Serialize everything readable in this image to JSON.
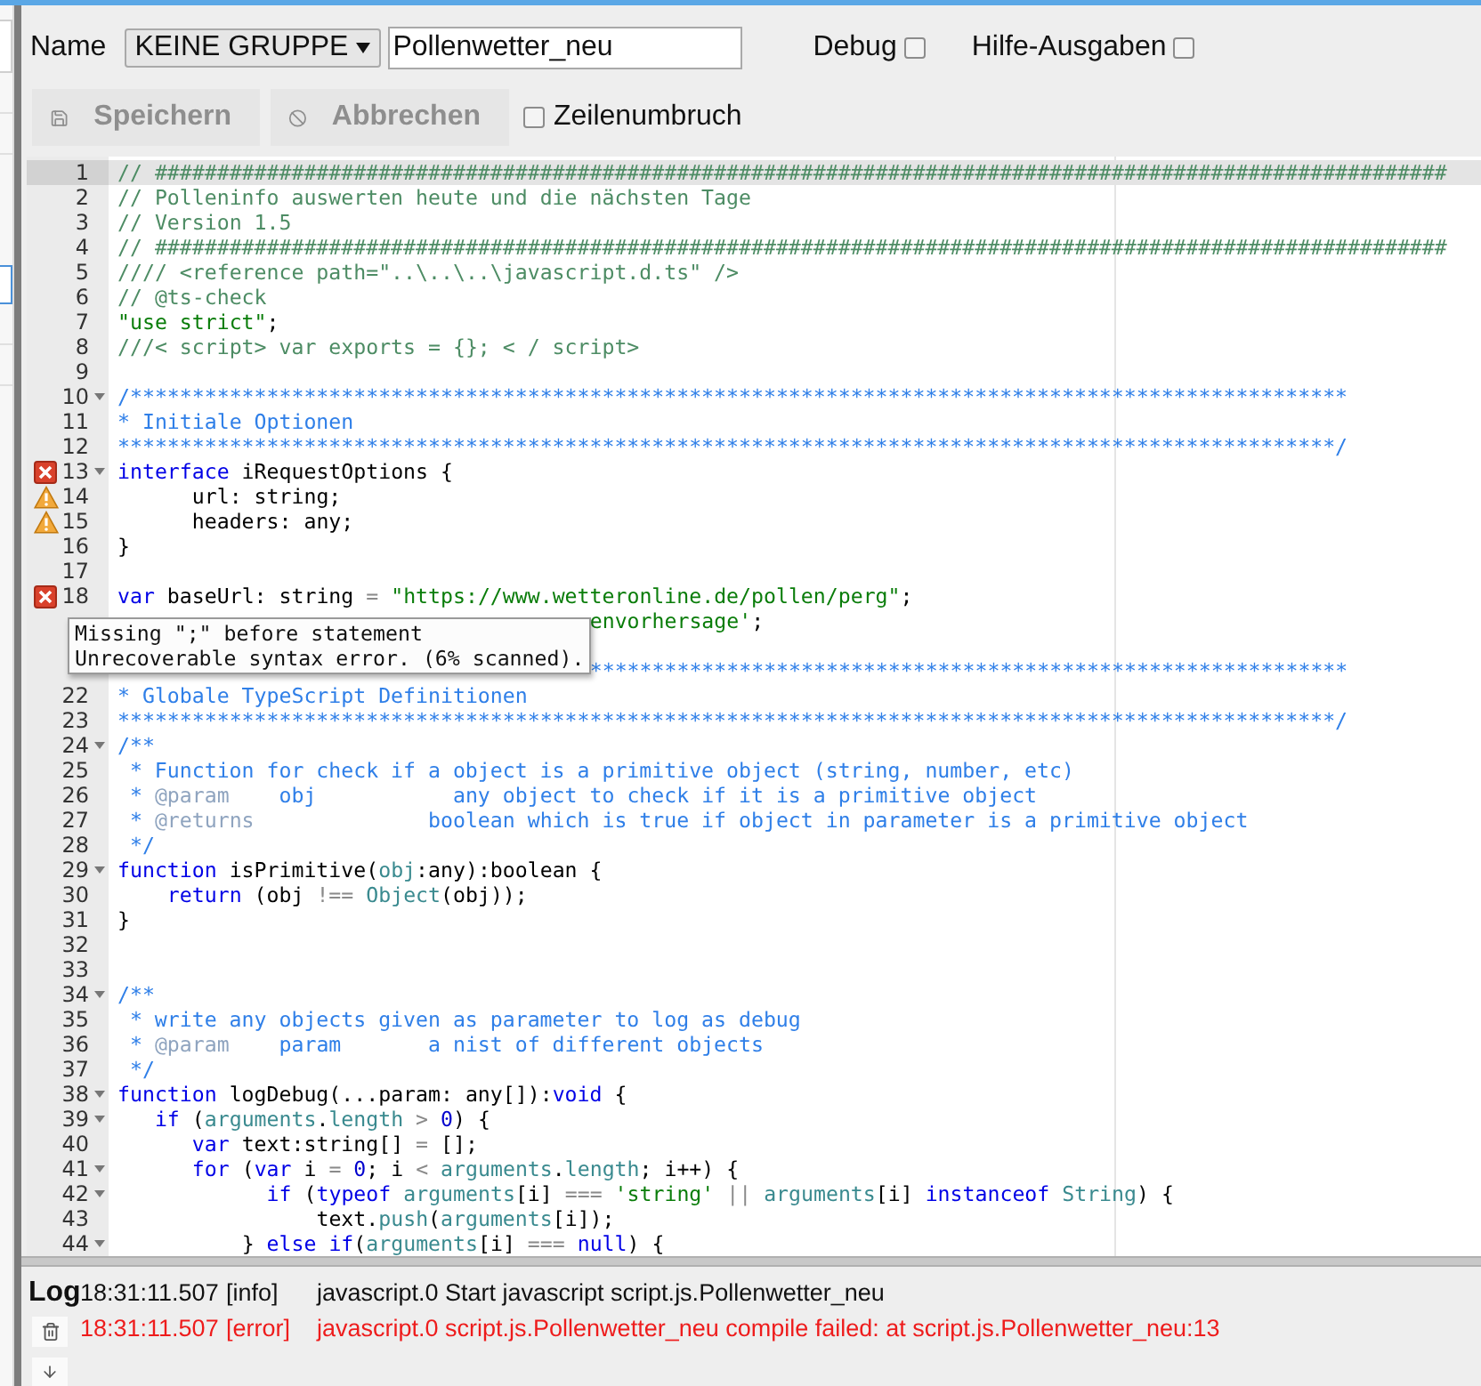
{
  "toolbar": {
    "name_label": "Name",
    "group_select": {
      "value": "KEINE GRUPPE"
    },
    "name_field": {
      "value": "Pollenwetter_neu"
    },
    "checkboxes": [
      {
        "label": "Debug",
        "checked": false
      },
      {
        "label": "Hilfe-Ausgaben",
        "checked": false
      }
    ],
    "buttons": [
      {
        "label": "Speichern",
        "kind": "save",
        "disabled": true
      },
      {
        "label": "Abbrechen",
        "kind": "cancel",
        "disabled": true
      }
    ],
    "wrap_checkbox": {
      "label": "Zeilenumbruch",
      "checked": false
    }
  },
  "editor": {
    "lines": [
      {
        "number": "1",
        "kind": "code",
        "fold": false,
        "active": true,
        "tokens": [
          {
            "kind": "comment",
            "text": "// ########################################################################################################"
          }
        ]
      },
      {
        "number": "2",
        "kind": "code",
        "fold": false,
        "active": false,
        "tokens": [
          {
            "kind": "comment",
            "text": "// Polleninfo auswerten heute und die nächsten Tage"
          }
        ]
      },
      {
        "number": "3",
        "kind": "code",
        "fold": false,
        "active": false,
        "tokens": [
          {
            "kind": "comment",
            "text": "// Version 1.5"
          }
        ]
      },
      {
        "number": "4",
        "kind": "code",
        "fold": false,
        "active": false,
        "tokens": [
          {
            "kind": "comment",
            "text": "// ########################################################################################################"
          }
        ]
      },
      {
        "number": "5",
        "kind": "code",
        "fold": false,
        "active": false,
        "tokens": [
          {
            "kind": "comment",
            "text": "//// <reference path=\"..\\..\\..\\javascript.d.ts\" />"
          }
        ]
      },
      {
        "number": "6",
        "kind": "code",
        "fold": false,
        "active": false,
        "tokens": [
          {
            "kind": "comment",
            "text": "// @ts-check"
          }
        ]
      },
      {
        "number": "7",
        "kind": "code",
        "fold": false,
        "active": false,
        "tokens": [
          {
            "kind": "string",
            "text": "\"use strict\""
          },
          {
            "kind": "plain",
            "text": ";"
          }
        ]
      },
      {
        "number": "8",
        "kind": "code",
        "fold": false,
        "active": false,
        "tokens": [
          {
            "kind": "comment",
            "text": "///< script> var exports = {}; < / script>"
          }
        ]
      },
      {
        "number": "9",
        "kind": "code",
        "fold": false,
        "active": false
      },
      {
        "number": "10",
        "kind": "code",
        "fold": true,
        "active": false,
        "tokens": [
          {
            "kind": "doc",
            "text": "/**************************************************************************************************"
          }
        ]
      },
      {
        "number": "11",
        "kind": "code",
        "fold": false,
        "active": false,
        "tokens": [
          {
            "kind": "doc",
            "text": "* Initiale Optionen"
          }
        ]
      },
      {
        "number": "12",
        "kind": "code",
        "fold": false,
        "active": false,
        "tokens": [
          {
            "kind": "doc",
            "text": "**************************************************************************************************/"
          }
        ]
      },
      {
        "number": "13",
        "kind": "error",
        "fold": true,
        "active": false,
        "tokens": [
          {
            "kind": "keyword",
            "text": "interface"
          },
          {
            "kind": "plain",
            "text": " iRequestOptions {"
          }
        ]
      },
      {
        "number": "14",
        "kind": "warning",
        "fold": false,
        "active": false,
        "tokens": [
          {
            "kind": "plain",
            "text": "      url: string;"
          }
        ]
      },
      {
        "number": "15",
        "kind": "warning",
        "fold": false,
        "active": false,
        "tokens": [
          {
            "kind": "plain",
            "text": "      headers: any;"
          }
        ]
      },
      {
        "number": "16",
        "kind": "code",
        "fold": false,
        "active": false,
        "tokens": [
          {
            "kind": "plain",
            "text": "}"
          }
        ]
      },
      {
        "number": "17",
        "kind": "code",
        "fold": false,
        "active": false
      },
      {
        "number": "18",
        "kind": "error",
        "fold": false,
        "active": false,
        "tokens": [
          {
            "kind": "keyword",
            "text": "var"
          },
          {
            "kind": "plain",
            "text": " baseUrl: string "
          },
          {
            "kind": "op",
            "text": "="
          },
          {
            "kind": "string",
            "text": " \"https://www.wetteronline.de/pollen/perg\""
          },
          {
            "kind": "plain",
            "text": ";"
          }
        ]
      },
      {
        "kind": "code",
        "fold": false,
        "active": false,
        "tokens": [
          {
            "kind": "string",
            "text": "                                      envorhersage'"
          },
          {
            "kind": "plain",
            "text": ";"
          }
        ]
      },
      {
        "kind": "code",
        "fold": false,
        "active": false
      },
      {
        "kind": "code",
        "fold": false,
        "active": false,
        "tokens": [
          {
            "kind": "doc",
            "text": "                                      *************************************************************"
          }
        ]
      },
      {
        "number": "22",
        "kind": "code",
        "fold": false,
        "active": false,
        "tokens": [
          {
            "kind": "doc",
            "text": "* Globale TypeScript Definitionen"
          }
        ]
      },
      {
        "number": "23",
        "kind": "code",
        "fold": false,
        "active": false,
        "tokens": [
          {
            "kind": "doc",
            "text": "**************************************************************************************************/"
          }
        ]
      },
      {
        "number": "24",
        "kind": "code",
        "fold": true,
        "active": false,
        "tokens": [
          {
            "kind": "doc",
            "text": "/**"
          }
        ]
      },
      {
        "number": "25",
        "kind": "code",
        "fold": false,
        "active": false,
        "tokens": [
          {
            "kind": "doc",
            "text": " * Function for check if a object is a primitive object (string, number, etc)"
          }
        ]
      },
      {
        "number": "26",
        "kind": "code",
        "fold": false,
        "active": false,
        "tokens": [
          {
            "kind": "doc",
            "text": " * "
          },
          {
            "kind": "doctag",
            "text": "@param"
          },
          {
            "kind": "doc",
            "text": "    obj           any object to check if it is a primitive object"
          }
        ]
      },
      {
        "number": "27",
        "kind": "code",
        "fold": false,
        "active": false,
        "tokens": [
          {
            "kind": "doc",
            "text": " * "
          },
          {
            "kind": "doctag",
            "text": "@returns"
          },
          {
            "kind": "doc",
            "text": "              boolean which is true if object in parameter is a primitive object"
          }
        ]
      },
      {
        "number": "28",
        "kind": "code",
        "fold": false,
        "active": false,
        "tokens": [
          {
            "kind": "doc",
            "text": " */"
          }
        ]
      },
      {
        "number": "29",
        "kind": "code",
        "fold": true,
        "active": false,
        "tokens": [
          {
            "kind": "keyword",
            "text": "function"
          },
          {
            "kind": "plain",
            "text": " isPrimitive("
          },
          {
            "kind": "builtin",
            "text": "obj"
          },
          {
            "kind": "plain",
            "text": ":any):boolean {"
          }
        ]
      },
      {
        "number": "30",
        "kind": "code",
        "fold": false,
        "active": false,
        "tokens": [
          {
            "kind": "keyword",
            "text": "    return"
          },
          {
            "kind": "plain",
            "text": " (obj "
          },
          {
            "kind": "op",
            "text": "!=="
          },
          {
            "kind": "builtin",
            "text": " Object"
          },
          {
            "kind": "plain",
            "text": "(obj));"
          }
        ]
      },
      {
        "number": "31",
        "kind": "code",
        "fold": false,
        "active": false,
        "tokens": [
          {
            "kind": "plain",
            "text": "}"
          }
        ]
      },
      {
        "number": "32",
        "kind": "code",
        "fold": false,
        "active": false
      },
      {
        "number": "33",
        "kind": "code",
        "fold": false,
        "active": false
      },
      {
        "number": "34",
        "kind": "code",
        "fold": true,
        "active": false,
        "tokens": [
          {
            "kind": "doc",
            "text": "/**"
          }
        ]
      },
      {
        "number": "35",
        "kind": "code",
        "fold": false,
        "active": false,
        "tokens": [
          {
            "kind": "doc",
            "text": " * write any objects given as parameter to log as debug"
          }
        ]
      },
      {
        "number": "36",
        "kind": "code",
        "fold": false,
        "active": false,
        "tokens": [
          {
            "kind": "doc",
            "text": " * "
          },
          {
            "kind": "doctag",
            "text": "@param"
          },
          {
            "kind": "doc",
            "text": "    param       a nist of different objects"
          }
        ]
      },
      {
        "number": "37",
        "kind": "code",
        "fold": false,
        "active": false,
        "tokens": [
          {
            "kind": "doc",
            "text": " */"
          }
        ]
      },
      {
        "number": "38",
        "kind": "code",
        "fold": true,
        "active": false,
        "tokens": [
          {
            "kind": "keyword",
            "text": "function"
          },
          {
            "kind": "plain",
            "text": " logDebug(...param: any[]):"
          },
          {
            "kind": "keyword",
            "text": "void"
          },
          {
            "kind": "plain",
            "text": " {"
          }
        ]
      },
      {
        "number": "39",
        "kind": "code",
        "fold": true,
        "active": false,
        "tokens": [
          {
            "kind": "keyword",
            "text": "   if"
          },
          {
            "kind": "plain",
            "text": " ("
          },
          {
            "kind": "builtin",
            "text": "arguments"
          },
          {
            "kind": "plain",
            "text": "."
          },
          {
            "kind": "builtin",
            "text": "length"
          },
          {
            "kind": "op",
            "text": " >"
          },
          {
            "kind": "number",
            "text": " 0"
          },
          {
            "kind": "plain",
            "text": ") {"
          }
        ]
      },
      {
        "number": "40",
        "kind": "code",
        "fold": false,
        "active": false,
        "tokens": [
          {
            "kind": "keyword",
            "text": "      var"
          },
          {
            "kind": "plain",
            "text": " text:string[] "
          },
          {
            "kind": "op",
            "text": "="
          },
          {
            "kind": "plain",
            "text": " [];"
          }
        ]
      },
      {
        "number": "41",
        "kind": "code",
        "fold": true,
        "active": false,
        "tokens": [
          {
            "kind": "keyword",
            "text": "      for"
          },
          {
            "kind": "plain",
            "text": " ("
          },
          {
            "kind": "keyword",
            "text": "var"
          },
          {
            "kind": "plain",
            "text": " i "
          },
          {
            "kind": "op",
            "text": "="
          },
          {
            "kind": "number",
            "text": " 0"
          },
          {
            "kind": "plain",
            "text": "; i "
          },
          {
            "kind": "op",
            "text": "<"
          },
          {
            "kind": "builtin",
            "text": " arguments"
          },
          {
            "kind": "plain",
            "text": "."
          },
          {
            "kind": "builtin",
            "text": "length"
          },
          {
            "kind": "plain",
            "text": "; i++) {"
          }
        ]
      },
      {
        "number": "42",
        "kind": "code",
        "fold": true,
        "active": false,
        "tokens": [
          {
            "kind": "keyword",
            "text": "            if"
          },
          {
            "kind": "plain",
            "text": " ("
          },
          {
            "kind": "keyword",
            "text": "typeof"
          },
          {
            "kind": "builtin",
            "text": " arguments"
          },
          {
            "kind": "plain",
            "text": "[i] "
          },
          {
            "kind": "op",
            "text": "==="
          },
          {
            "kind": "string",
            "text": " 'string'"
          },
          {
            "kind": "op",
            "text": " ||"
          },
          {
            "kind": "builtin",
            "text": " arguments"
          },
          {
            "kind": "plain",
            "text": "[i] "
          },
          {
            "kind": "keyword",
            "text": "instanceof"
          },
          {
            "kind": "builtin",
            "text": " String"
          },
          {
            "kind": "plain",
            "text": ") {"
          }
        ]
      },
      {
        "number": "43",
        "kind": "code",
        "fold": false,
        "active": false,
        "tokens": [
          {
            "kind": "plain",
            "text": "                text."
          },
          {
            "kind": "builtin",
            "text": "push"
          },
          {
            "kind": "plain",
            "text": "("
          },
          {
            "kind": "builtin",
            "text": "arguments"
          },
          {
            "kind": "plain",
            "text": "[i]);"
          }
        ]
      },
      {
        "number": "44",
        "kind": "code",
        "fold": true,
        "active": false,
        "tokens": [
          {
            "kind": "plain",
            "text": "          } "
          },
          {
            "kind": "keyword",
            "text": "else"
          },
          {
            "kind": "keyword",
            "text": " if"
          },
          {
            "kind": "plain",
            "text": "("
          },
          {
            "kind": "builtin",
            "text": "arguments"
          },
          {
            "kind": "plain",
            "text": "[i] "
          },
          {
            "kind": "op",
            "text": "==="
          },
          {
            "kind": "keyword",
            "text": " null"
          },
          {
            "kind": "plain",
            "text": ") {"
          }
        ]
      }
    ],
    "tooltip": [
      "Missing \";\" before statement",
      "Unrecoverable syntax error. (6% scanned)."
    ]
  },
  "log": {
    "title": "Log",
    "entries": [
      {
        "time": "18:31:11.507",
        "level": "[info]",
        "kind": "info",
        "message": "javascript.0 Start javascript script.js.Pollenwetter_neu"
      },
      {
        "time": "18:31:11.507",
        "level": "[error]",
        "kind": "error",
        "message": "javascript.0 script.js.Pollenwetter_neu compile failed: at script.js.Pollenwetter_neu:13"
      }
    ]
  }
}
